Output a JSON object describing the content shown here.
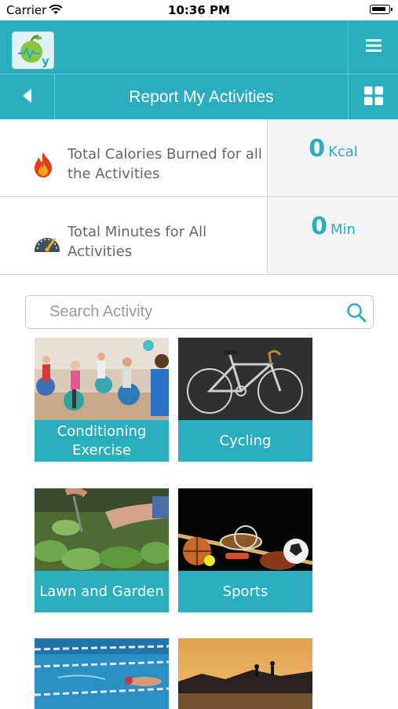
{
  "status_bar": {
    "carrier": "Carrier",
    "time": "10:36 PM"
  },
  "header": {
    "title": "Report My Activities"
  },
  "stats": {
    "calories": {
      "label": "Total Calories Burned for all the Activities",
      "value": "0",
      "unit": "Kcal"
    },
    "minutes": {
      "label": "Total Minutes for All Activities",
      "value": "0",
      "unit": "Min"
    }
  },
  "search": {
    "placeholder": "Search Activity",
    "value": ""
  },
  "activities": [
    {
      "label": "Conditioning Exercise"
    },
    {
      "label": "Cycling"
    },
    {
      "label": "Lawn and Garden"
    },
    {
      "label": "Sports"
    },
    {
      "label": ""
    },
    {
      "label": ""
    }
  ],
  "colors": {
    "accent": "#2aaebd",
    "stat_bg": "#f4f4f4",
    "label_text": "#666666"
  },
  "icons": [
    "wifi-icon",
    "battery-icon",
    "app-logo-icon",
    "hamburger-menu-icon",
    "back-arrow-icon",
    "grid-view-icon",
    "flame-icon",
    "speedometer-icon",
    "search-icon"
  ]
}
